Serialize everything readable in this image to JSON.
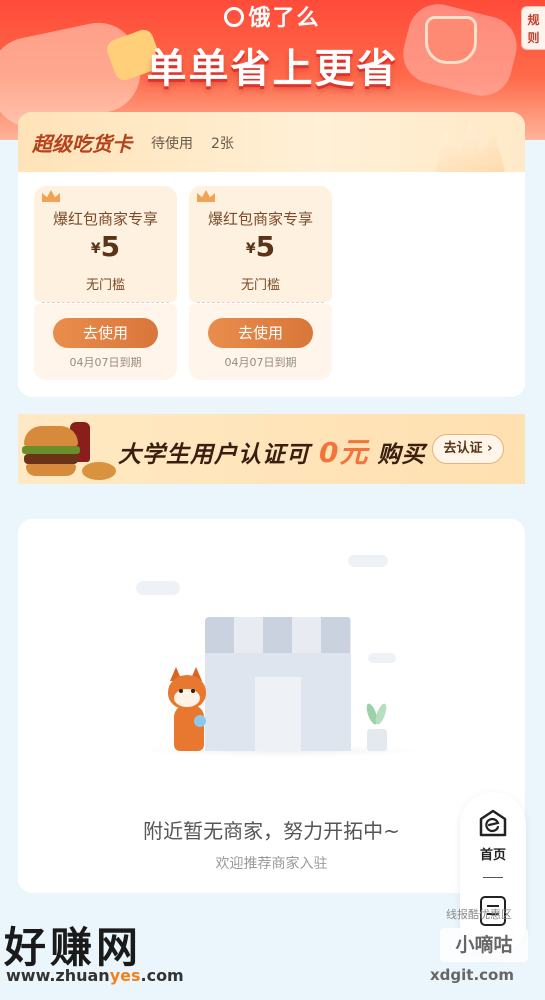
{
  "banner": {
    "brand": "饿了么",
    "slogan": "单单省上更省",
    "rules_label": "规则"
  },
  "super_card": {
    "title": "超级吃货卡",
    "status": "待使用",
    "count": "2张",
    "coupons": [
      {
        "name": "爆红包商家专享",
        "currency": "¥",
        "amount": "5",
        "condition": "无门槛",
        "button": "去使用",
        "expire": "04月07日到期"
      },
      {
        "name": "爆红包商家专享",
        "currency": "¥",
        "amount": "5",
        "condition": "无门槛",
        "button": "去使用",
        "expire": "04月07日到期"
      }
    ]
  },
  "promo": {
    "text_before": "大学生用户认证可",
    "highlight": "0元",
    "text_after": "购买",
    "button": "去认证 ›"
  },
  "empty_state": {
    "title": "附近暂无商家，努力开拓中~",
    "subtitle": "欢迎推荐商家入驻"
  },
  "side_nav": {
    "home_label": "首页"
  },
  "watermarks": {
    "left_logo": "好赚网",
    "left_domain_a": "www.zhuan",
    "left_domain_b": "yes",
    "left_domain_c": ".com",
    "right_site_cn": "线报酷优惠区",
    "right_box": "小嘀咕",
    "right_domain": "xdgit.com"
  },
  "colors": {
    "banner_red": "#ff4b3a",
    "coupon_button": "#d9763b",
    "promo_highlight": "#f2743a",
    "page_bg": "#eaf6fb"
  },
  "icons": [
    "eleme-logo-icon",
    "crown-icon",
    "store-illustration",
    "shiba-mascot",
    "home-icon",
    "order-icon"
  ]
}
